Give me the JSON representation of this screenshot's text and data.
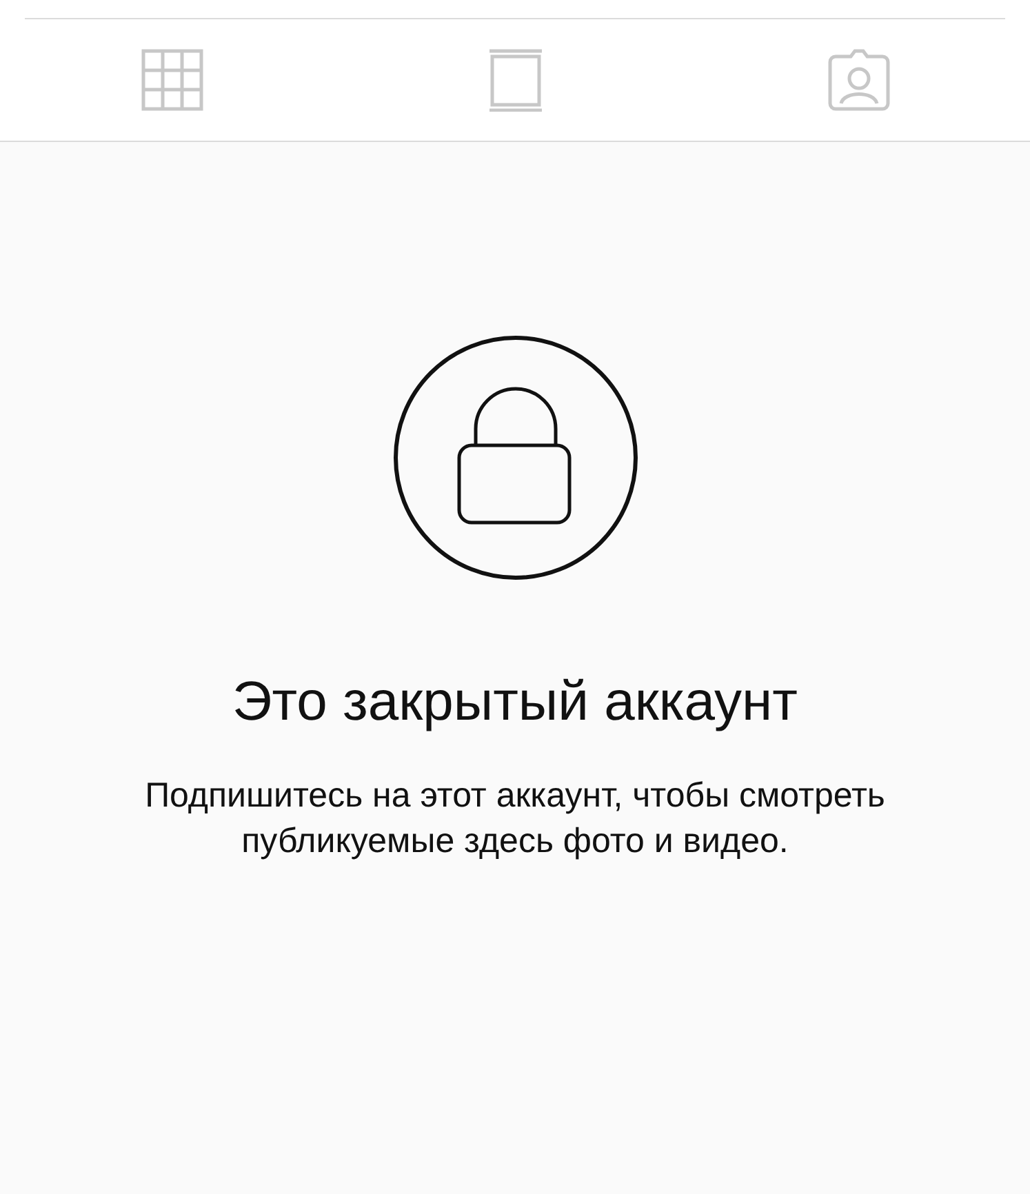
{
  "tabs": [
    {
      "kind": "grid",
      "selected": false
    },
    {
      "kind": "feed",
      "selected": false
    },
    {
      "kind": "tagged",
      "selected": false
    }
  ],
  "private_notice": {
    "title": "Это закрытый аккаунт",
    "message": "Подпишитесь на этот аккаунт, чтобы смотреть публикуемые здесь фото и видео."
  }
}
